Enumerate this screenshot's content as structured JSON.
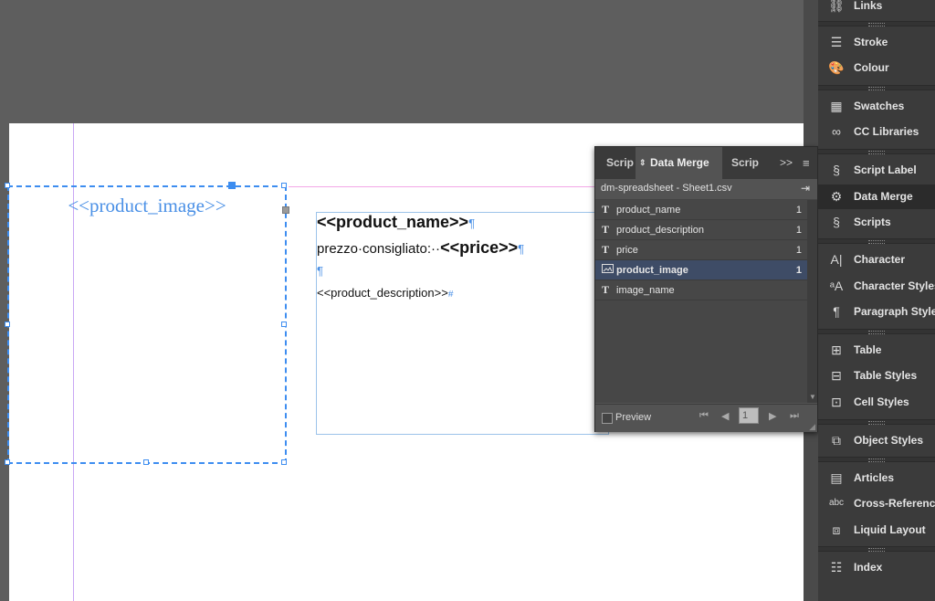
{
  "canvas": {
    "image_placeholder": "<<product_image>>",
    "text_frame": {
      "name_field": "<<product_name>>",
      "price_label": "prezzo·consigliato:··",
      "price_field": "<<price>>",
      "description_field": "<<product_description>>",
      "pilcrow": "¶",
      "end_mark": "#"
    }
  },
  "data_merge_panel": {
    "tabs": {
      "scripts_left": "Scrip",
      "data_merge": "Data Merge",
      "scripts_right": "Scrip",
      "more": ">>"
    },
    "source_file": "dm-spreadsheet - Sheet1.csv",
    "fields": [
      {
        "icon": "text-field-icon",
        "name": "product_name",
        "count": "1"
      },
      {
        "icon": "text-field-icon",
        "name": "product_description",
        "count": "1"
      },
      {
        "icon": "text-field-icon",
        "name": "price",
        "count": "1"
      },
      {
        "icon": "image-field-icon",
        "name": "product_image",
        "count": "1",
        "selected": true
      },
      {
        "icon": "text-field-icon",
        "name": "image_name",
        "count": ""
      }
    ],
    "footer": {
      "preview_label": "Preview",
      "record_number": "1"
    }
  },
  "dock": {
    "links": "Links",
    "stroke": "Stroke",
    "colour": "Colour",
    "swatches": "Swatches",
    "cc_libraries": "CC Libraries",
    "script_label": "Script Label",
    "data_merge": "Data Merge",
    "scripts": "Scripts",
    "character": "Character",
    "character_styles": "Character Styles",
    "paragraph_styles": "Paragraph Styles",
    "table": "Table",
    "table_styles": "Table Styles",
    "cell_styles": "Cell Styles",
    "object_styles": "Object Styles",
    "articles": "Articles",
    "cross_references": "Cross-References",
    "liquid_layout": "Liquid Layout",
    "index": "Index"
  }
}
